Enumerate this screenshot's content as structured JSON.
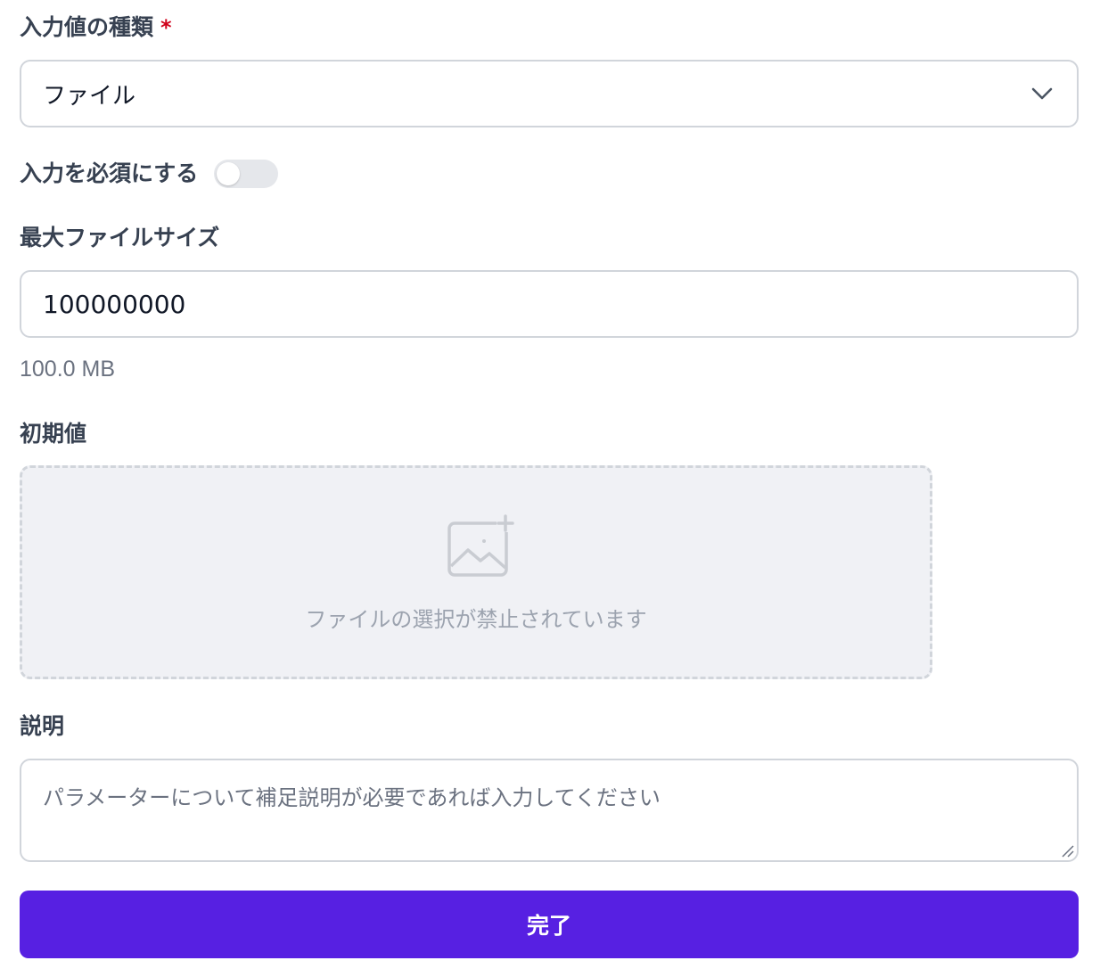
{
  "input_type": {
    "label": "入力値の種類",
    "required_mark": "*",
    "selected": "ファイル"
  },
  "required_toggle": {
    "label": "入力を必須にする",
    "on": false
  },
  "max_file_size": {
    "label": "最大ファイルサイズ",
    "value": "100000000",
    "hint": "100.0 MB"
  },
  "initial_value": {
    "label": "初期値",
    "dropzone_text": "ファイルの選択が禁止されています",
    "icon": "image-plus-icon"
  },
  "description": {
    "label": "説明",
    "placeholder": "パラメーターについて補足説明が必要であれば入力してください"
  },
  "submit": {
    "label": "完了"
  },
  "colors": {
    "primary": "#5720e2",
    "required": "#d0021b",
    "border": "#d1d5db",
    "dropzone_bg": "#f0f1f5"
  }
}
